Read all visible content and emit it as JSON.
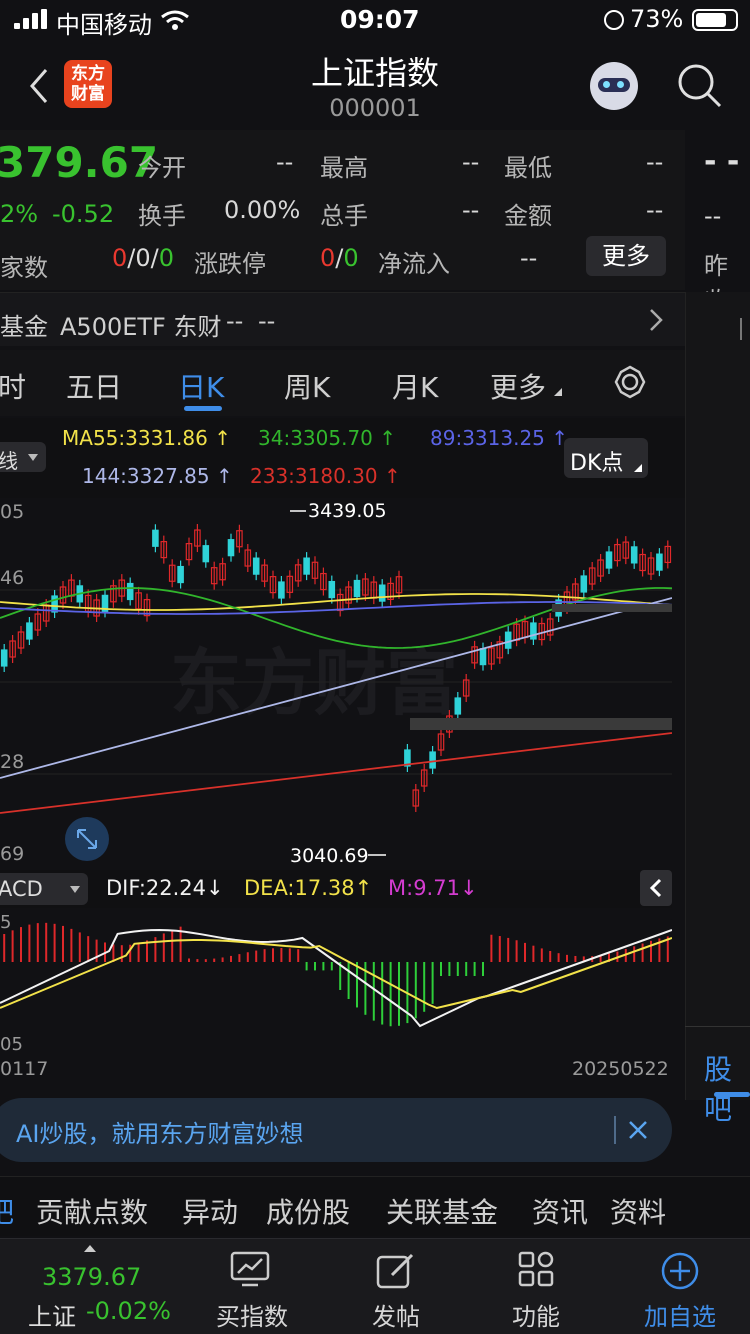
{
  "status_bar": {
    "carrier": "中国移动",
    "time": "09:07",
    "battery": "73%"
  },
  "header": {
    "title": "上证指数",
    "code": "000001",
    "logo_text": "东方\n财富"
  },
  "quote": {
    "price": "379.67",
    "pct": "2%",
    "change": "-0.52",
    "count_label": "家数",
    "open_label": "今开",
    "open": "--",
    "high_label": "最高",
    "high": "--",
    "low_label": "最低",
    "low": "--",
    "turnover_label": "换手",
    "turnover": "0.00%",
    "volume_label": "总手",
    "volume": "--",
    "amount_label": "金额",
    "amount": "--",
    "updown_a": "0",
    "updown_b": "/0/",
    "updown_c": "0",
    "limit_label": "涨跌停",
    "limit_a": "0",
    "limit_b": "/",
    "limit_c": "0",
    "inflow_label": "净流入",
    "inflow": "--",
    "more": "更多",
    "right_dash": "- -",
    "right_sub": "--",
    "prev_close_label": "昨收"
  },
  "fund": {
    "label": "基金",
    "name": "A500ETF 东财",
    "v1": "--",
    "v2": "--"
  },
  "tabs": [
    {
      "label": "时"
    },
    {
      "label": "五日"
    },
    {
      "label": "日K",
      "active": true
    },
    {
      "label": "周K"
    },
    {
      "label": "月K"
    },
    {
      "label": "更多"
    }
  ],
  "ma": {
    "ma55": "MA55:3331.86",
    "ma34": "34:3305.70",
    "ma89": "89:3313.25",
    "ma144": "144:3327.85",
    "ma233": "233:3180.30",
    "mode_label": "线",
    "dk": "DK点",
    "up_arrow": "↑",
    "down_arrow": "↓"
  },
  "chart_axes": {
    "y1": "05",
    "y2": "46",
    "y3": "28",
    "y4": "69",
    "high_label": "3439.05",
    "low_label": "3040.69",
    "watermark": "东方财富"
  },
  "macd": {
    "label": "ACD",
    "dif": "DIF:22.24",
    "dea": "DEA:17.38",
    "m": "M:9.71",
    "y_top": "5",
    "y_bot": "05"
  },
  "dates": {
    "start": "0117",
    "end": "20250522"
  },
  "right_panel": {
    "tab": "股吧"
  },
  "ad": {
    "text": "AI炒股，就用东方财富妙想"
  },
  "subtabs": [
    {
      "label": "吧"
    },
    {
      "label": "贡献点数"
    },
    {
      "label": "异动"
    },
    {
      "label": "成份股"
    },
    {
      "label": "关联基金"
    },
    {
      "label": "资讯"
    },
    {
      "label": "资料"
    }
  ],
  "bottom": {
    "price": "3379.67",
    "name": "上证",
    "pct": "-0.02%",
    "buy": "买指数",
    "post": "发帖",
    "func": "功能",
    "add": "加自选"
  },
  "chart_data": {
    "type": "candlestick",
    "labels": {
      "high": "3439.05",
      "low": "3040.69"
    },
    "x_start": "0117",
    "x_end": "20250522",
    "moving_averages": [
      {
        "name": "MA55",
        "value": 3331.86,
        "color": "#f2e24a"
      },
      {
        "name": "MA34",
        "value": 3305.7,
        "color": "#31b52c"
      },
      {
        "name": "MA89",
        "value": 3313.25,
        "color": "#5b64e6"
      },
      {
        "name": "MA144",
        "value": 3327.85,
        "color": "#aeb8e8"
      },
      {
        "name": "MA233",
        "value": 3180.3,
        "color": "#d8312a"
      }
    ],
    "macd": {
      "DIF": 22.24,
      "DEA": 17.38,
      "M": 9.71
    }
  }
}
